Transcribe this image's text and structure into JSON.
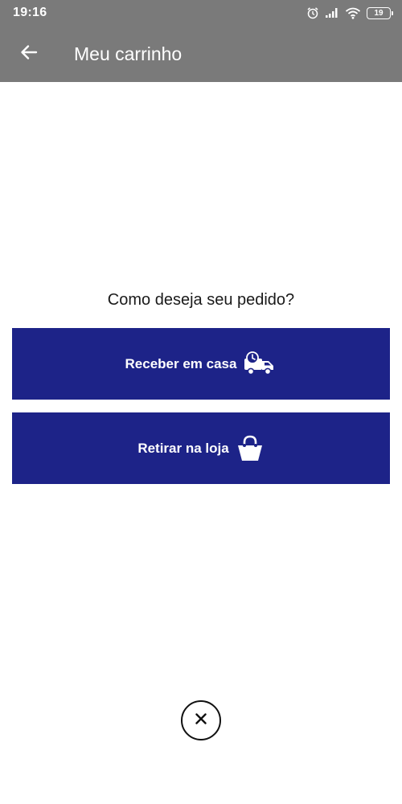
{
  "status_bar": {
    "time": "19:16",
    "battery": "19",
    "icons": [
      "alarm-icon",
      "signal-icon",
      "wifi-icon",
      "battery-icon"
    ]
  },
  "app_bar": {
    "back_icon": "arrow-left-icon",
    "title": "Meu carrinho",
    "background": "#7a7a7a"
  },
  "main": {
    "question": "Como deseja seu pedido?",
    "options": [
      {
        "label": "Receber em casa",
        "icon": "delivery-truck-icon"
      },
      {
        "label": "Retirar na loja",
        "icon": "shopping-basket-icon"
      }
    ],
    "button_color": "#1d2388"
  },
  "footer": {
    "close_icon": "close-icon"
  }
}
